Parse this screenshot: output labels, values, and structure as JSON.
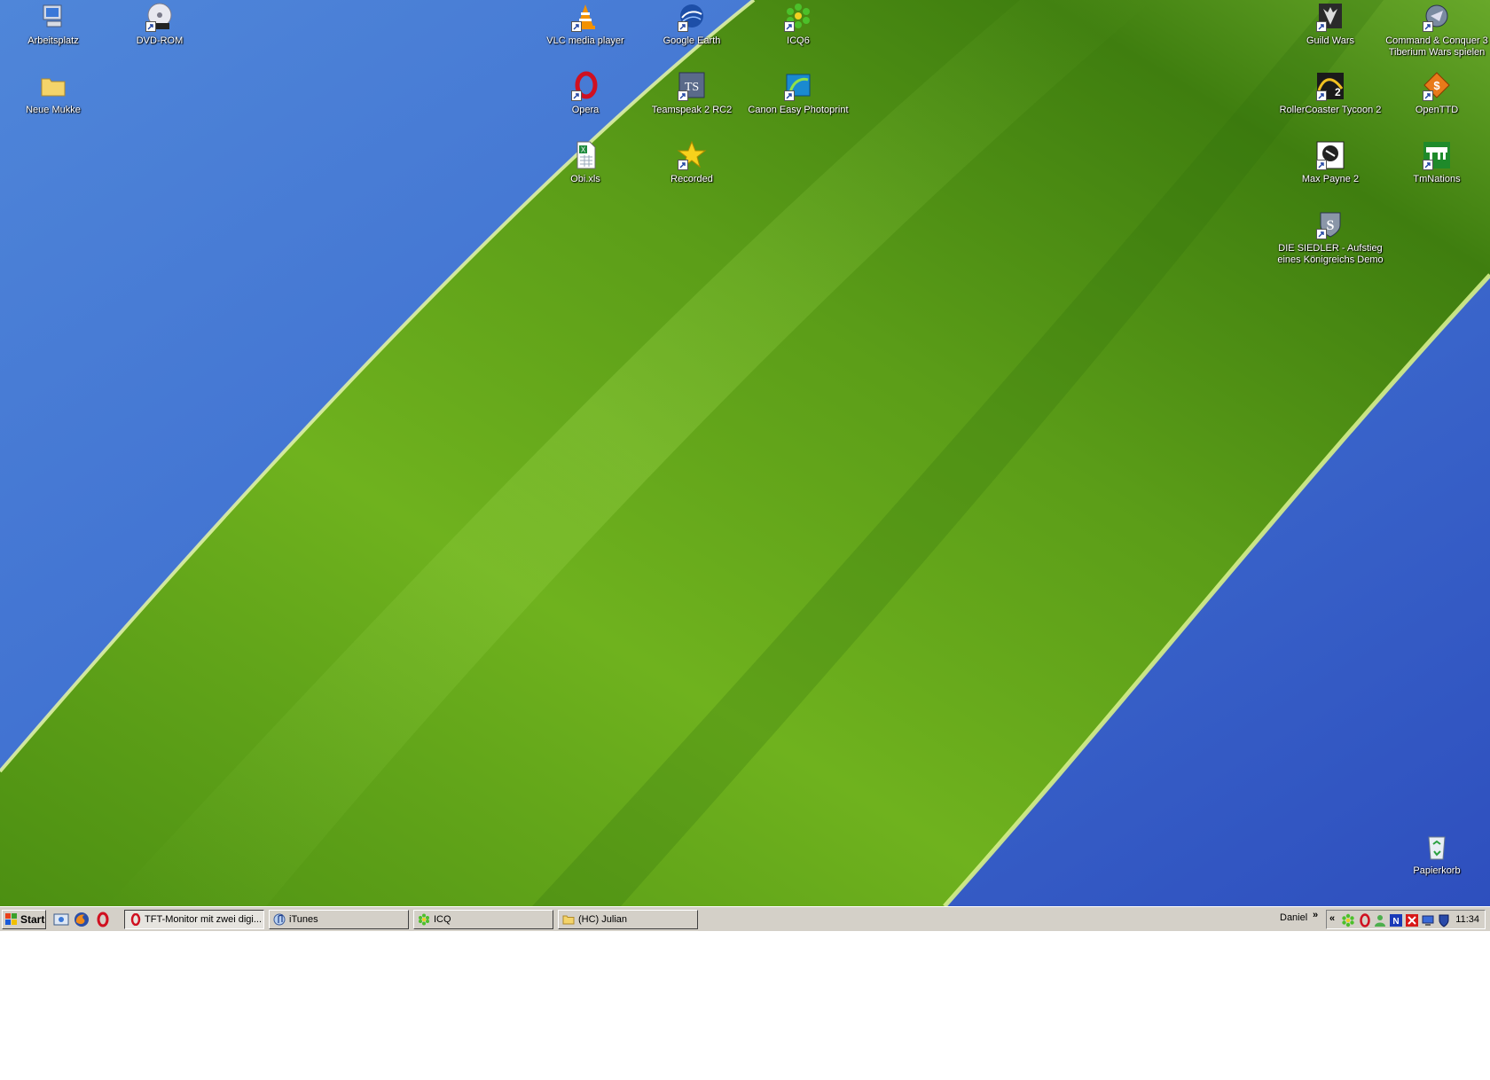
{
  "desktop": {
    "icons": [
      {
        "label": "Arbeitsplatz",
        "icon": "my-computer-icon"
      },
      {
        "label": "DVD-ROM",
        "icon": "dvd-drive-icon"
      },
      {
        "label": "Neue Mukke",
        "icon": "folder-icon"
      },
      {
        "label": "VLC media player",
        "icon": "vlc-cone-icon"
      },
      {
        "label": "Google Earth",
        "icon": "google-earth-icon"
      },
      {
        "label": "ICQ6",
        "icon": "icq-flower-icon"
      },
      {
        "label": "Opera",
        "icon": "opera-icon"
      },
      {
        "label": "Teamspeak 2 RC2",
        "icon": "teamspeak-icon"
      },
      {
        "label": "Canon Easy Photoprint",
        "icon": "canon-photoprint-icon"
      },
      {
        "label": "Obi.xls",
        "icon": "excel-file-icon"
      },
      {
        "label": "Recorded",
        "icon": "star-icon"
      },
      {
        "label": "Guild Wars",
        "icon": "guild-wars-icon"
      },
      {
        "label": "Command & Conquer 3 Tiberium Wars spielen",
        "icon": "cnc3-icon"
      },
      {
        "label": "RollerCoaster Tycoon 2",
        "icon": "rct2-icon"
      },
      {
        "label": "OpenTTD",
        "icon": "openttd-icon"
      },
      {
        "label": "Max Payne 2",
        "icon": "max-payne-icon"
      },
      {
        "label": "TmNations",
        "icon": "tmnations-icon"
      },
      {
        "label": "DIE SIEDLER - Aufstieg eines Königreichs Demo",
        "icon": "siedler-icon"
      },
      {
        "label": "Papierkorb",
        "icon": "recycle-bin-icon"
      }
    ]
  },
  "taskbar": {
    "start_label": "Start",
    "quick_launch": [
      "show-desktop-icon",
      "firefox-icon",
      "opera-icon"
    ],
    "tasks": [
      {
        "label": "TFT-Monitor mit zwei digi...",
        "icon": "opera-icon"
      },
      {
        "label": "iTunes",
        "icon": "itunes-icon"
      },
      {
        "label": "ICQ",
        "icon": "icq-flower-icon"
      },
      {
        "label": "(HC) Julian",
        "icon": "folder-icon"
      }
    ],
    "user_label": "Daniel",
    "more_chevron": "»",
    "tray_collapse": "«",
    "tray_icons": [
      "icq-tray-icon",
      "opera-tray-icon",
      "contacts-tray-icon",
      "network-tray-icon",
      "antivirus-tray-icon",
      "monitor-tray-icon",
      "shield-tray-icon"
    ],
    "clock": "11:34"
  },
  "colors": {
    "wallpaper_blue": "#3a5fcd",
    "leaf_green": "#5fa31a",
    "taskbar_gray": "#d4d0c8"
  }
}
